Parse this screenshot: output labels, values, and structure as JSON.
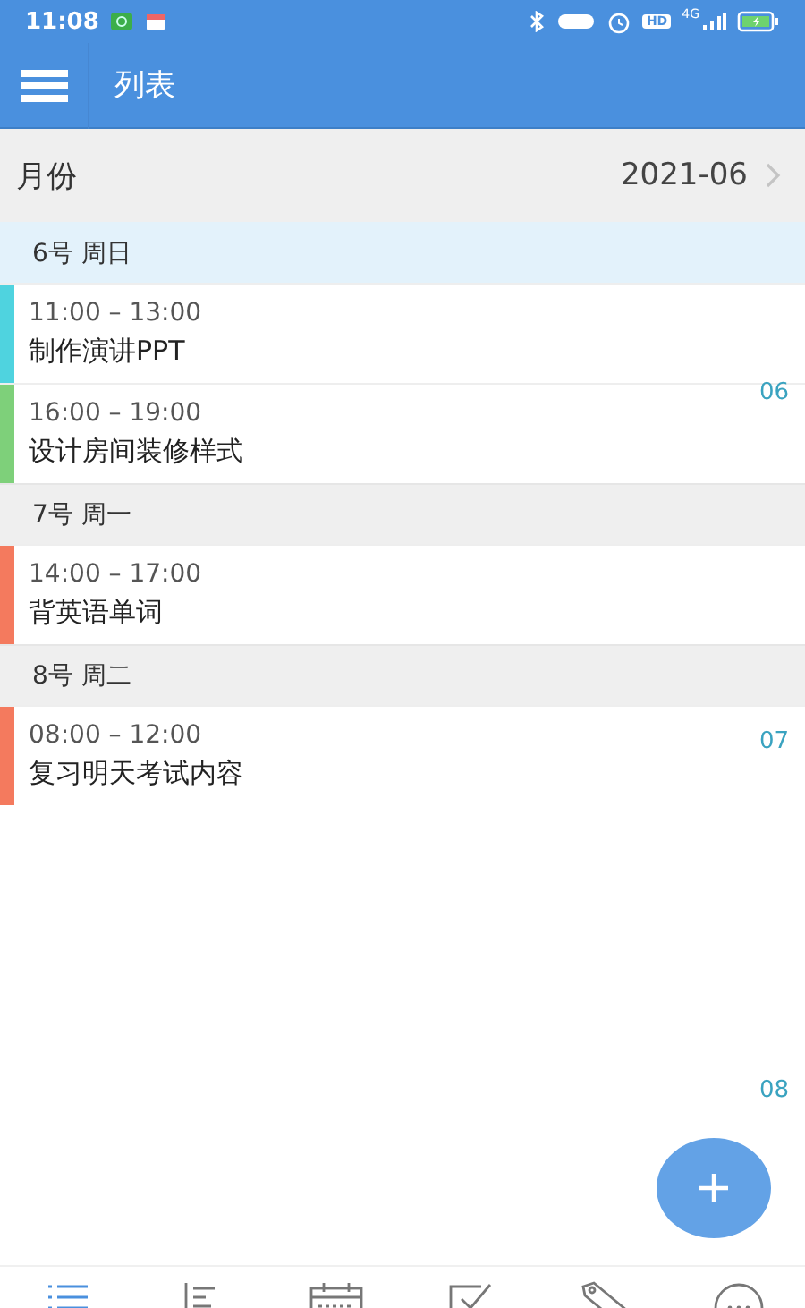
{
  "status_bar": {
    "time": "11:08",
    "hd": "HD",
    "network": "4G"
  },
  "app_bar": {
    "title": "列表"
  },
  "month_row": {
    "label": "月份",
    "value": "2021-06"
  },
  "days": [
    {
      "label": "6号 周日",
      "highlighted": true,
      "events": [
        {
          "time": "11:00 – 13:00",
          "title": "制作演讲PPT",
          "color": "#4fd3df"
        },
        {
          "time": "16:00 – 19:00",
          "title": "设计房间装修样式",
          "color": "#7ed07a"
        }
      ]
    },
    {
      "label": "7号 周一",
      "highlighted": false,
      "events": [
        {
          "time": "14:00 – 17:00",
          "title": "背英语单词",
          "color": "#f47a5e"
        }
      ]
    },
    {
      "label": "8号 周二",
      "highlighted": false,
      "events": [
        {
          "time": "08:00 – 12:00",
          "title": "复习明天考试内容",
          "color": "#f47a5e"
        }
      ]
    }
  ],
  "side_labels": [
    "06",
    "07",
    "08"
  ],
  "bottom_nav": [
    {
      "kind": "list",
      "selected": true
    },
    {
      "kind": "sort",
      "selected": false
    },
    {
      "kind": "calendar",
      "selected": false
    },
    {
      "kind": "check",
      "selected": false
    },
    {
      "kind": "tag",
      "selected": false
    },
    {
      "kind": "more",
      "selected": false
    }
  ]
}
